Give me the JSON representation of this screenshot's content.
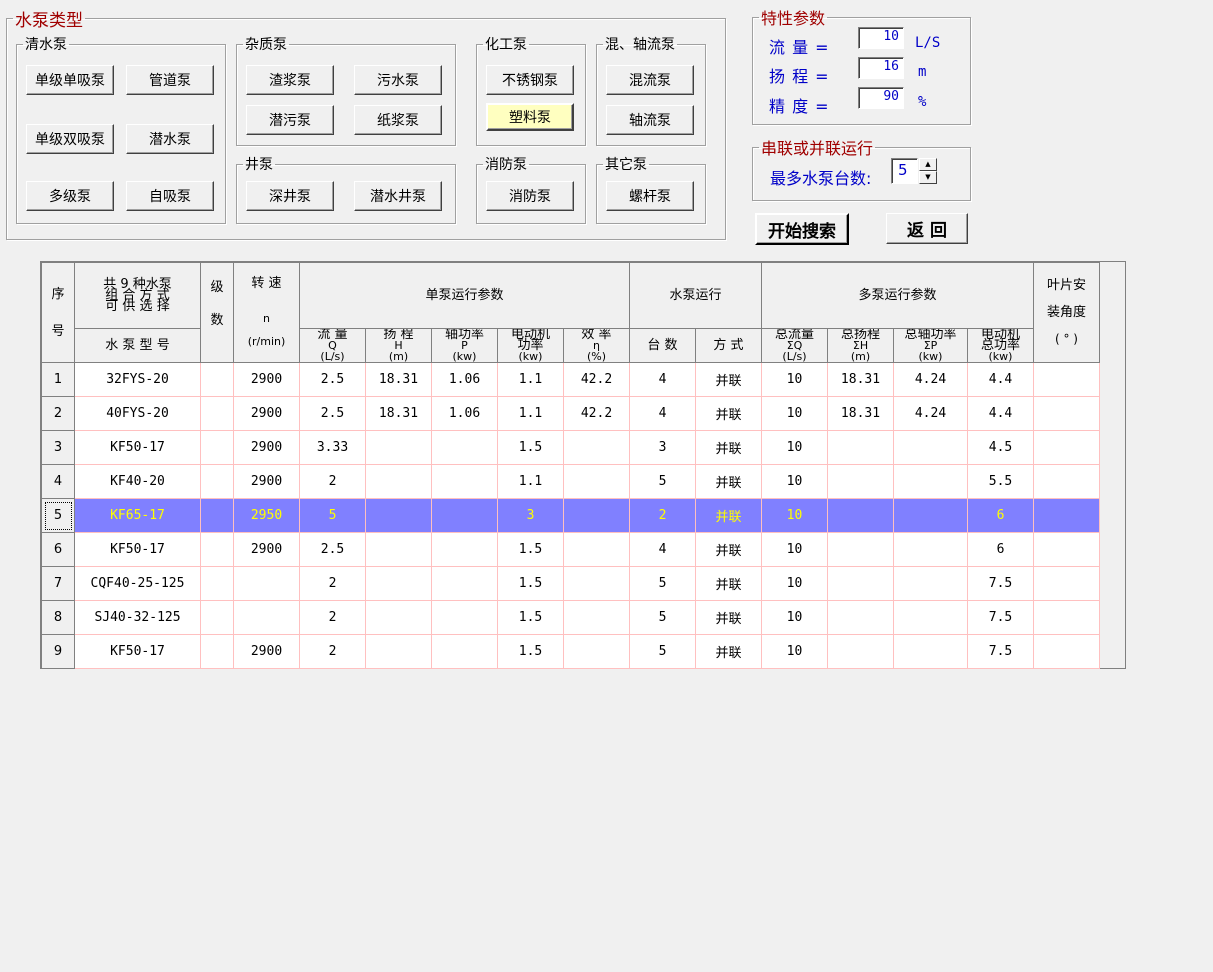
{
  "pump_types": {
    "title": "水泵类型",
    "clear": {
      "title": "清水泵",
      "buttons": [
        "单级单吸泵",
        "管道泵",
        "单级双吸泵",
        "潜水泵",
        "多级泵",
        "自吸泵"
      ]
    },
    "misc": {
      "title": "杂质泵",
      "buttons": [
        "渣浆泵",
        "污水泵",
        "潜污泵",
        "纸浆泵"
      ]
    },
    "well": {
      "title": "井泵",
      "buttons": [
        "深井泵",
        "潜水井泵"
      ]
    },
    "chem": {
      "title": "化工泵",
      "buttons": [
        "不锈钢泵",
        "塑料泵"
      ]
    },
    "fire": {
      "title": "消防泵",
      "buttons": [
        "消防泵"
      ]
    },
    "mixed": {
      "title": "混、轴流泵",
      "buttons": [
        "混流泵",
        "轴流泵"
      ]
    },
    "other": {
      "title": "其它泵",
      "buttons": [
        "螺杆泵"
      ]
    },
    "selected_button": "塑料泵"
  },
  "params": {
    "title": "特性参数",
    "flow_label": "流 量 =",
    "flow_value": "10",
    "flow_unit": "L/S",
    "head_label": "扬 程 =",
    "head_value": "16",
    "head_unit": "m",
    "precision_label": "精 度 =",
    "precision_value": "90",
    "precision_unit": "%"
  },
  "series": {
    "title": "串联或并联运行",
    "max_label": "最多水泵台数:",
    "max_value": "5"
  },
  "actions": {
    "search": "开始搜索",
    "back": "返 回"
  },
  "table": {
    "headers": {
      "idx_top": "序",
      "idx_bottom": "号",
      "combo_line1": "共 9 种水泵",
      "combo_line2": "组 合 方 式",
      "combo_line3": "可 供 选 择",
      "model": "水 泵 型 号",
      "stage_top": "级",
      "stage_bottom": "数",
      "speed_top": "转 速",
      "speed_mid": "n",
      "speed_unit": "(r/min)",
      "single_group": "单泵运行参数",
      "q_name": "流 量",
      "q_sym": "Q",
      "q_unit": "(L/s)",
      "h_name": "扬 程",
      "h_sym": "H",
      "h_unit": "(m)",
      "p_name": "轴功率",
      "p_sym": "P",
      "p_unit": "(kw)",
      "m_name1": "电动机",
      "m_name2": "功率",
      "m_unit": "(kw)",
      "e_name": "效 率",
      "e_sym": "η",
      "e_unit": "(%)",
      "run_group": "水泵运行",
      "count": "台 数",
      "mode": "方 式",
      "multi_group": "多泵运行参数",
      "tq_name": "总流量",
      "tq_sym": "ΣQ",
      "tq_unit": "(L/s)",
      "th_name": "总扬程",
      "th_sym": "ΣH",
      "th_unit": "(m)",
      "tp_name": "总轴功率",
      "tp_sym": "ΣP",
      "tp_unit": "(kw)",
      "tm_name1": "电动机",
      "tm_name2": "总功率",
      "tm_unit": "(kw)",
      "blade_top": "叶片安",
      "blade_mid": "装角度",
      "blade_unit": "( ° )"
    },
    "rows": [
      {
        "idx": "1",
        "model": "32FYS-20",
        "stage": "",
        "speed": "2900",
        "q": "2.5",
        "h": "18.31",
        "p": "1.06",
        "m": "1.1",
        "e": "42.2",
        "count": "4",
        "mode": "并联",
        "tq": "10",
        "th": "18.31",
        "tp": "4.24",
        "tm": "4.4",
        "blade": ""
      },
      {
        "idx": "2",
        "model": "40FYS-20",
        "stage": "",
        "speed": "2900",
        "q": "2.5",
        "h": "18.31",
        "p": "1.06",
        "m": "1.1",
        "e": "42.2",
        "count": "4",
        "mode": "并联",
        "tq": "10",
        "th": "18.31",
        "tp": "4.24",
        "tm": "4.4",
        "blade": ""
      },
      {
        "idx": "3",
        "model": "KF50-17",
        "stage": "",
        "speed": "2900",
        "q": "3.33",
        "h": "",
        "p": "",
        "m": "1.5",
        "e": "",
        "count": "3",
        "mode": "并联",
        "tq": "10",
        "th": "",
        "tp": "",
        "tm": "4.5",
        "blade": ""
      },
      {
        "idx": "4",
        "model": "KF40-20",
        "stage": "",
        "speed": "2900",
        "q": "2",
        "h": "",
        "p": "",
        "m": "1.1",
        "e": "",
        "count": "5",
        "mode": "并联",
        "tq": "10",
        "th": "",
        "tp": "",
        "tm": "5.5",
        "blade": ""
      },
      {
        "idx": "5",
        "model": "KF65-17",
        "stage": "",
        "speed": "2950",
        "q": "5",
        "h": "",
        "p": "",
        "m": "3",
        "e": "",
        "count": "2",
        "mode": "并联",
        "tq": "10",
        "th": "",
        "tp": "",
        "tm": "6",
        "blade": ""
      },
      {
        "idx": "6",
        "model": "KF50-17",
        "stage": "",
        "speed": "2900",
        "q": "2.5",
        "h": "",
        "p": "",
        "m": "1.5",
        "e": "",
        "count": "4",
        "mode": "并联",
        "tq": "10",
        "th": "",
        "tp": "",
        "tm": "6",
        "blade": ""
      },
      {
        "idx": "7",
        "model": "CQF40-25-125",
        "stage": "",
        "speed": "",
        "q": "2",
        "h": "",
        "p": "",
        "m": "1.5",
        "e": "",
        "count": "5",
        "mode": "并联",
        "tq": "10",
        "th": "",
        "tp": "",
        "tm": "7.5",
        "blade": ""
      },
      {
        "idx": "8",
        "model": "SJ40-32-125",
        "stage": "",
        "speed": "",
        "q": "2",
        "h": "",
        "p": "",
        "m": "1.5",
        "e": "",
        "count": "5",
        "mode": "并联",
        "tq": "10",
        "th": "",
        "tp": "",
        "tm": "7.5",
        "blade": ""
      },
      {
        "idx": "9",
        "model": "KF50-17",
        "stage": "",
        "speed": "2900",
        "q": "2",
        "h": "",
        "p": "",
        "m": "1.5",
        "e": "",
        "count": "5",
        "mode": "并联",
        "tq": "10",
        "th": "",
        "tp": "",
        "tm": "7.5",
        "blade": ""
      }
    ],
    "selected_row": "5"
  },
  "colors": {
    "selection_bg": "#8080ff",
    "selection_text": "#ffff00",
    "label_blue": "#0000c8",
    "legend_red": "#a00000",
    "grid_line": "#ffc0c0"
  }
}
